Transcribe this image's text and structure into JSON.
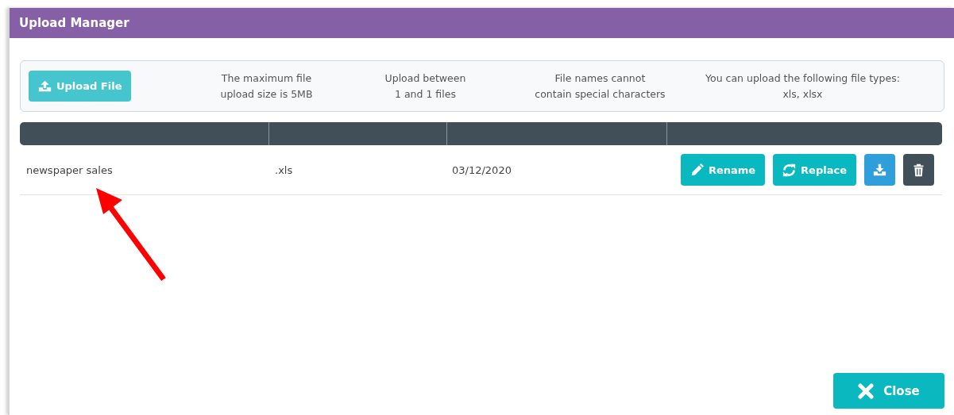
{
  "window": {
    "title": "Upload Manager"
  },
  "upload_button": {
    "label": "Upload File"
  },
  "info": [
    "The maximum file\nupload size is 5MB",
    "Upload between\n1 and 1 files",
    "File names cannot\ncontain special characters",
    "You can upload the following file types:\nxls, xlsx"
  ],
  "table": {
    "rows": [
      {
        "name": "newspaper sales",
        "extension": ".xls",
        "date": "03/12/2020",
        "actions": [
          {
            "kind": "rename",
            "label": "Rename"
          },
          {
            "kind": "replace",
            "label": "Replace"
          },
          {
            "kind": "download"
          },
          {
            "kind": "delete"
          }
        ]
      }
    ]
  },
  "close_button": {
    "label": "Close"
  }
}
